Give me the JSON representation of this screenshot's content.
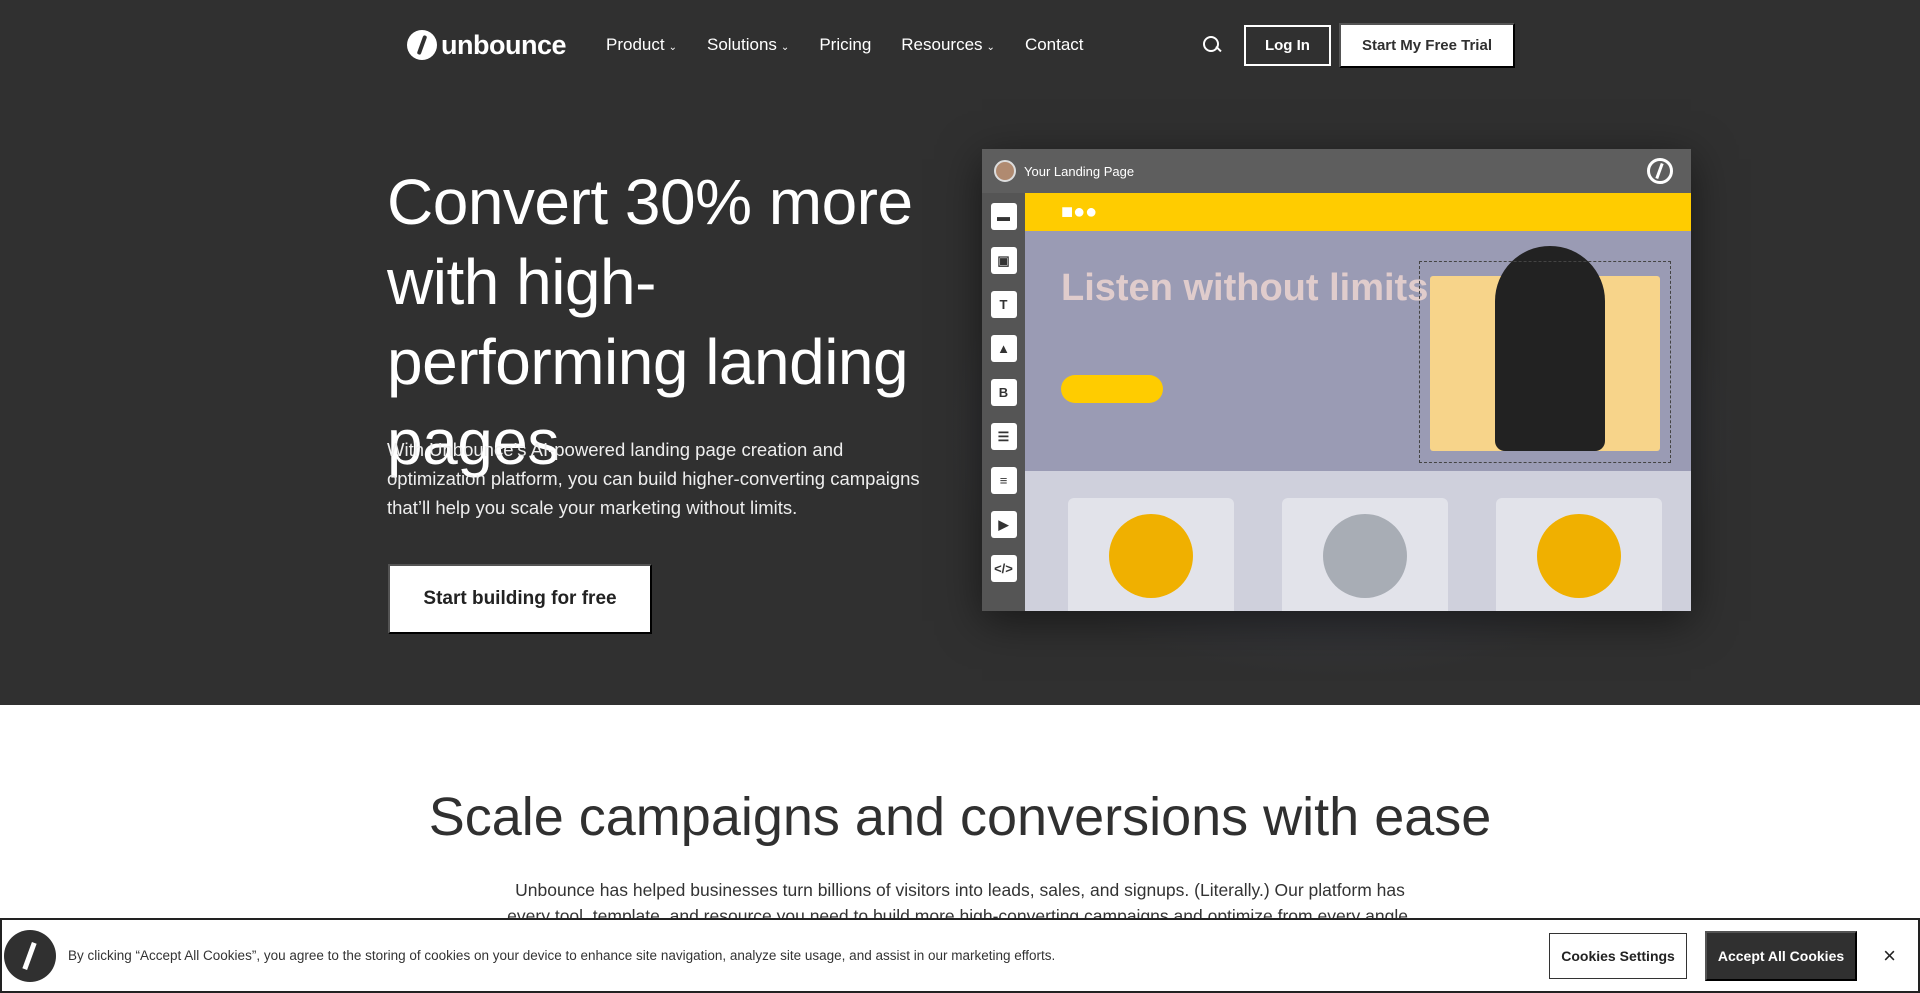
{
  "nav": {
    "logo": "unbounce",
    "items": [
      {
        "label": "Product",
        "dropdown": true
      },
      {
        "label": "Solutions",
        "dropdown": true
      },
      {
        "label": "Pricing",
        "dropdown": false
      },
      {
        "label": "Resources",
        "dropdown": true
      },
      {
        "label": "Contact",
        "dropdown": false
      }
    ],
    "login": "Log In",
    "trial": "Start My Free Trial"
  },
  "hero": {
    "title": "Convert 30% more with high-performing landing pages",
    "lead": "With Unbounce’s AI-powered landing page creation and optimization platform, you can build higher-converting campaigns that’ll help you scale your marketing without limits.",
    "cta": "Start building for free"
  },
  "mockup": {
    "title": "Your Landing Page",
    "brand": "■●●",
    "headline": "Listen without limits",
    "tools": [
      "section",
      "box",
      "T",
      "image",
      "B",
      "form",
      "list",
      "video",
      "</>"
    ]
  },
  "section2": {
    "title": "Scale campaigns and conversions with ease",
    "text": "Unbounce has helped businesses turn billions of visitors into leads, sales, and signups. (Literally.) Our platform has every tool, template, and resource you need to build more high-converting campaigns and optimize from every angle."
  },
  "cookie": {
    "text": "By clicking “Accept All Cookies”, you agree to the storing of cookies on your device to enhance site navigation, analyze site usage, and assist in our marketing efforts.",
    "settings": "Cookies Settings",
    "accept": "Accept All Cookies",
    "close": "×"
  },
  "colors": {
    "dark": "#303030",
    "yellow": "#ffcc00",
    "purple": "#9a9bb4"
  }
}
